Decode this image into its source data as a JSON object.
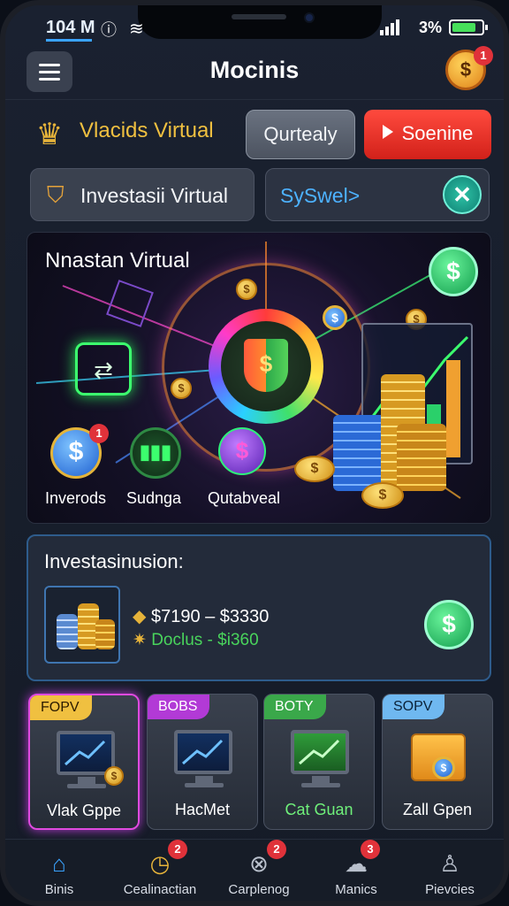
{
  "status": {
    "time": "104 M",
    "battery": "3%"
  },
  "header": {
    "title": "Mocinis",
    "badge": "1"
  },
  "row1": {
    "label": "Vlacids Virtual",
    "button1": "Qurtealy",
    "button2": "Soenine"
  },
  "row2": {
    "invest_label": "Investasii Virtual",
    "sys_label": "SySwel>"
  },
  "hero": {
    "title": "Nnastan Virtual",
    "items": [
      {
        "label": "Inverods",
        "badge": "1"
      },
      {
        "label": "Sudnga"
      },
      {
        "label": "Qutabveal"
      }
    ]
  },
  "summary": {
    "title": "Investasinusion:",
    "line1": "$7190 – $3330",
    "line2": "Doclus - $i360"
  },
  "cards": [
    {
      "tag": "FOPV",
      "label": "Vlak Gppe"
    },
    {
      "tag": "BOBS",
      "label": "HacMet"
    },
    {
      "tag": "BOTY",
      "label": "Cat Guan"
    },
    {
      "tag": "SOPV",
      "label": "Zall Gpen"
    }
  ],
  "nav": [
    {
      "label": "Binis",
      "icon": "home-icon"
    },
    {
      "label": "Cealinactian",
      "icon": "clock-icon",
      "badge": "2"
    },
    {
      "label": "Carplenog",
      "icon": "cancel-icon",
      "badge": "2"
    },
    {
      "label": "Manics",
      "icon": "chat-icon",
      "badge": "3"
    },
    {
      "label": "Pievcies",
      "icon": "person-icon"
    }
  ],
  "colors": {
    "accent": "#3aa3ff",
    "primary_button": "#e8312a",
    "gold": "#f0c040",
    "positive": "#49d45c"
  }
}
